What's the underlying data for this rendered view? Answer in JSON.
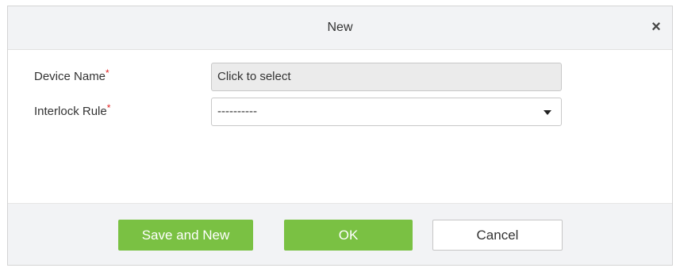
{
  "dialog": {
    "title": "New",
    "close_icon": "close-icon",
    "close_glyph": "×"
  },
  "form": {
    "device_name": {
      "label": "Device Name",
      "required_mark": "*",
      "value": "Click to select"
    },
    "interlock_rule": {
      "label": "Interlock Rule",
      "required_mark": "*",
      "selected_value": "----------",
      "caret_icon": "caret-down-icon"
    }
  },
  "footer": {
    "save_and_new_label": "Save and New",
    "ok_label": "OK",
    "cancel_label": "Cancel"
  },
  "colors": {
    "accent_green": "#7ac143",
    "required_red": "#e02020",
    "header_bg": "#f2f3f5"
  }
}
